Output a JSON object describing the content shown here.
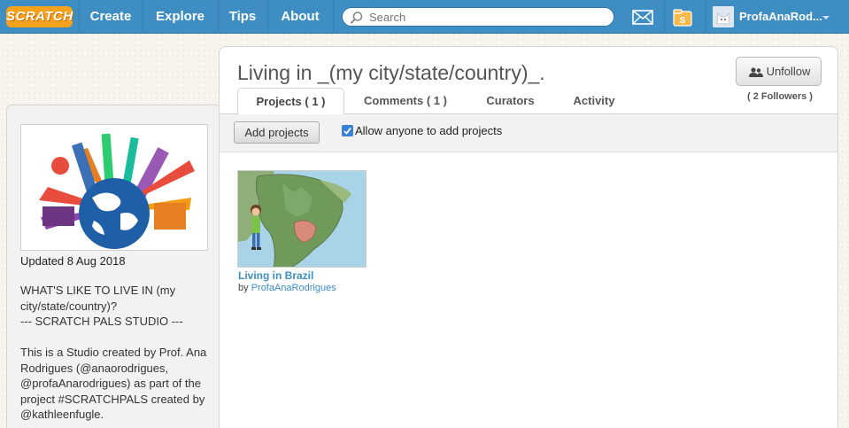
{
  "nav": {
    "logo": "SCRATCH",
    "items": [
      {
        "label": "Create"
      },
      {
        "label": "Explore"
      },
      {
        "label": "Tips"
      },
      {
        "label": "About"
      }
    ],
    "search_placeholder": "Search",
    "icons": {
      "messages": "envelope-icon",
      "my_stuff": "folder-icon"
    },
    "username": "ProfaAnaRod..."
  },
  "sidebar": {
    "updated": "Updated 8 Aug 2018",
    "description_lines": [
      "WHAT'S LIKE TO LIVE IN (my",
      "city/state/country)?",
      "--- SCRATCH PALS STUDIO ---",
      "",
      "This is a Studio created by Prof. Ana",
      "Rodrigues (@anaorodrigues,",
      "@profaAnarodrigues) as part of the",
      "project #SCRATCHPALS created by",
      "@kathleenfugle."
    ]
  },
  "studio": {
    "title": "Living in _(my city/state/country)_.",
    "unfollow_label": "Unfollow",
    "followers": "( 2 Followers )",
    "tabs": [
      {
        "label": "Projects ( 1 )",
        "active": true
      },
      {
        "label": "Comments ( 1 )",
        "active": false
      },
      {
        "label": "Curators",
        "active": false
      },
      {
        "label": "Activity",
        "active": false
      }
    ],
    "add_projects_label": "Add projects",
    "allow_anyone_label": "Allow anyone to add projects",
    "allow_anyone_checked": true
  },
  "projects": [
    {
      "title": "Living in Brazil",
      "by_prefix": "by",
      "author": "ProfaAnaRodrigues"
    }
  ],
  "colors": {
    "nav_blue": "#3e8ec4",
    "logo_orange": "#f7a21b",
    "link_blue": "#3e8ec4"
  }
}
